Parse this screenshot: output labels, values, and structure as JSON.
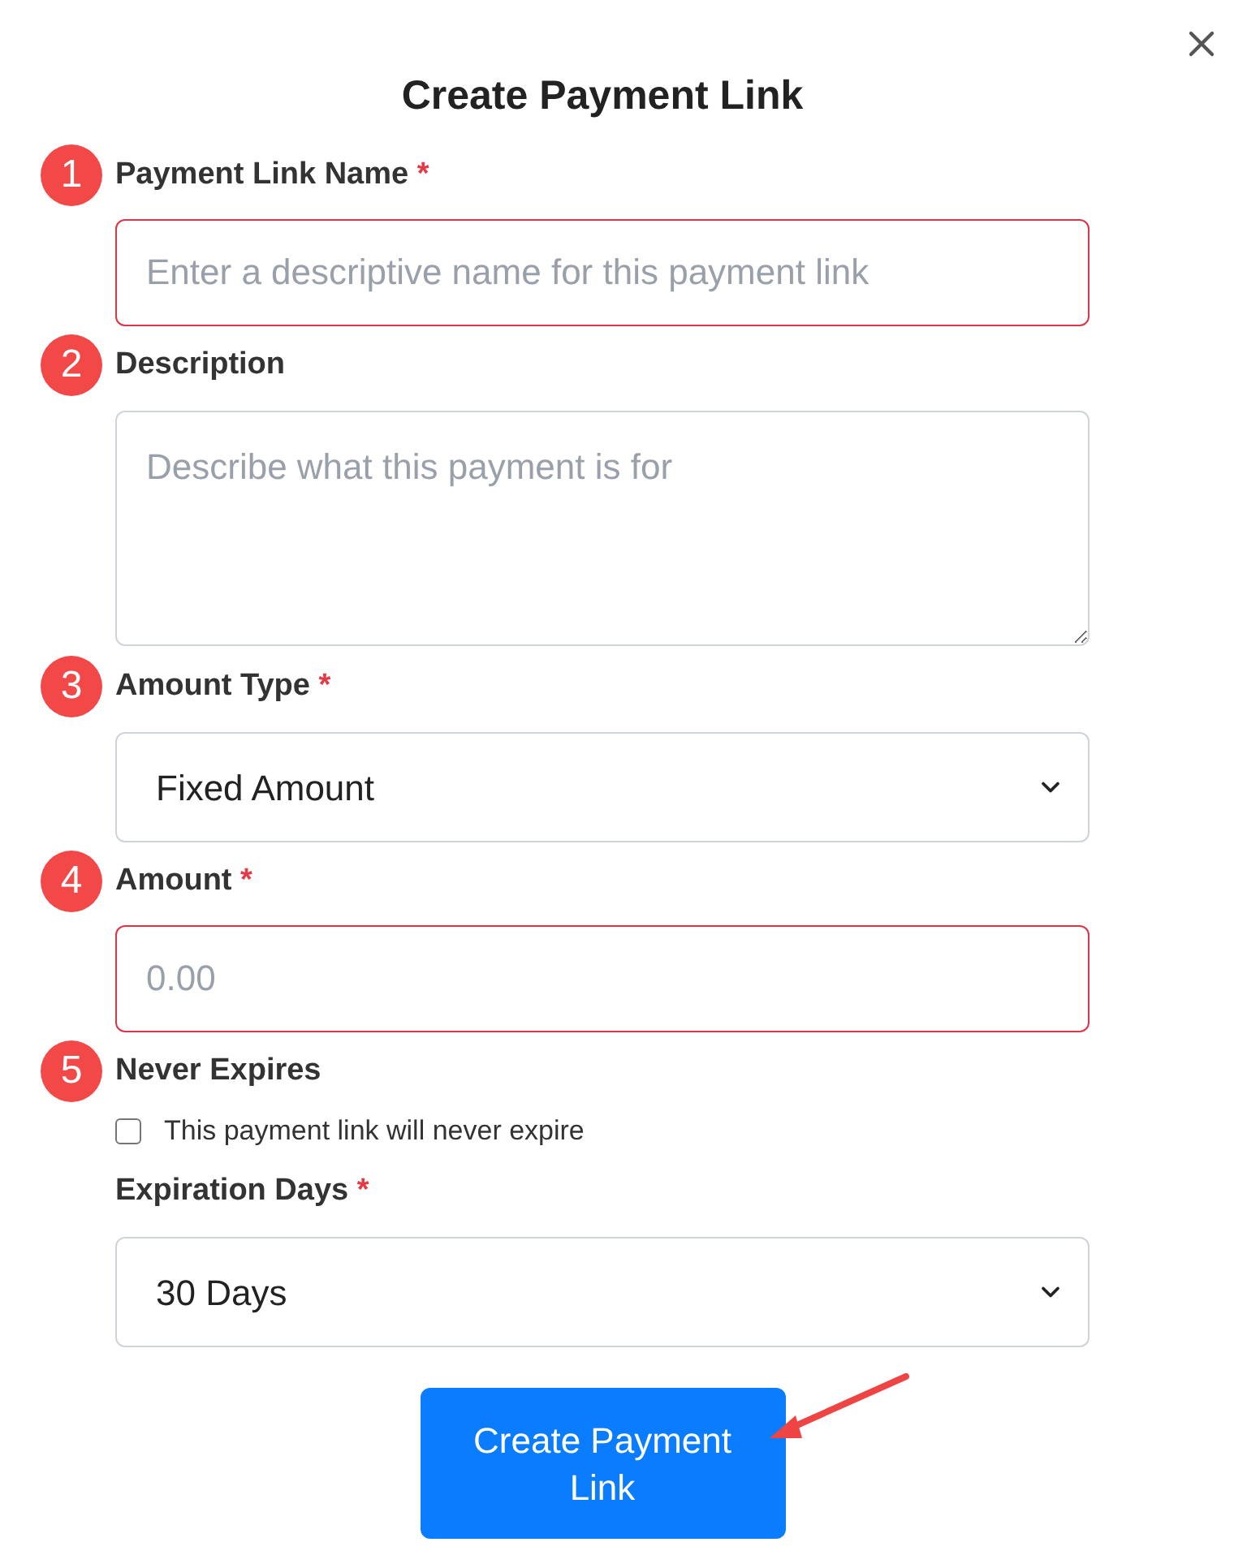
{
  "dialog": {
    "title": "Create Payment Link"
  },
  "fields": [
    {
      "kind": "text",
      "marker": "1",
      "label": "Payment Link Name",
      "required_mark": "*",
      "placeholder": "Enter a descriptive name for this payment link",
      "invalid": true
    },
    {
      "kind": "textarea",
      "marker": "2",
      "label": "Description",
      "placeholder": "Describe what this payment is for",
      "invalid": false
    },
    {
      "kind": "select",
      "marker": "3",
      "label": "Amount Type",
      "required_mark": "*",
      "value": "Fixed Amount",
      "invalid": false
    },
    {
      "kind": "text",
      "marker": "4",
      "label": "Amount",
      "required_mark": "*",
      "placeholder": "0.00",
      "invalid": true
    },
    {
      "kind": "checkbox",
      "marker": "5",
      "label": "Never Expires",
      "option": "This payment link will never expire",
      "checked": false
    },
    {
      "kind": "select",
      "label": "Expiration Days",
      "required_mark": "*",
      "value": "30 Days",
      "invalid": false
    }
  ],
  "submit": {
    "label": "Create Payment Link"
  }
}
